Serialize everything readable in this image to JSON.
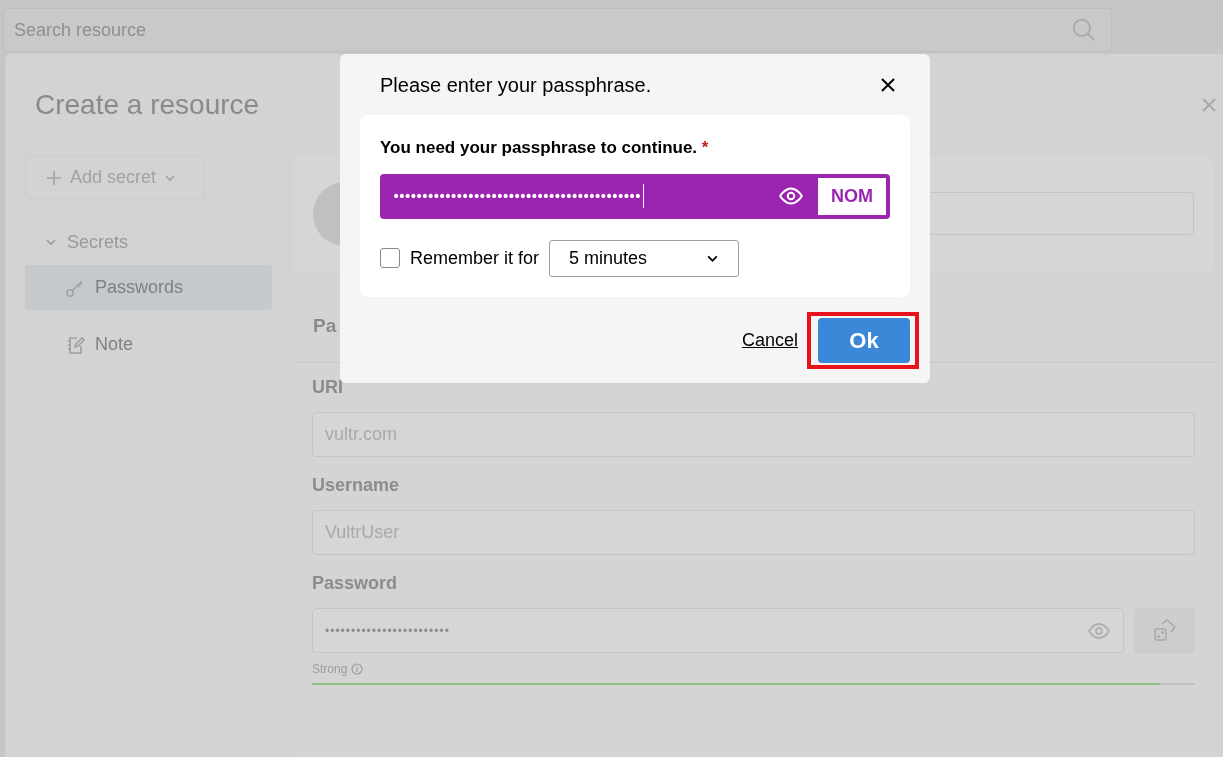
{
  "search": {
    "placeholder": "Search resource"
  },
  "panel": {
    "title": "Create a resource"
  },
  "sidebar": {
    "add_button": "Add secret",
    "tree": [
      {
        "label": "Secrets",
        "expanded": true,
        "children": [
          {
            "label": "Passwords",
            "selected": true,
            "kind": "key"
          },
          {
            "label": "Note",
            "selected": false,
            "kind": "note"
          }
        ]
      }
    ]
  },
  "section": {
    "heading": "Pa",
    "fields": [
      {
        "label": "URI",
        "placeholder": "vultr.com",
        "kind": "text"
      },
      {
        "label": "Username",
        "placeholder": "VultrUser",
        "kind": "text"
      },
      {
        "label": "Password",
        "value": "••••••••••••••••••••••••",
        "kind": "password"
      }
    ],
    "strength": {
      "label": "Strong",
      "level": 0.96
    }
  },
  "dialog": {
    "title": "Please enter your passphrase.",
    "label": "You need your passphrase to continue.",
    "required_mark": "*",
    "passphrase": "•••••••••••••••••••••••••••••••••••••••••••",
    "badge": "NOM",
    "remember": {
      "label": "Remember it for",
      "checked": false
    },
    "duration": "5 minutes",
    "cancel": "Cancel",
    "ok": "Ok",
    "ok_highlighted": true
  }
}
